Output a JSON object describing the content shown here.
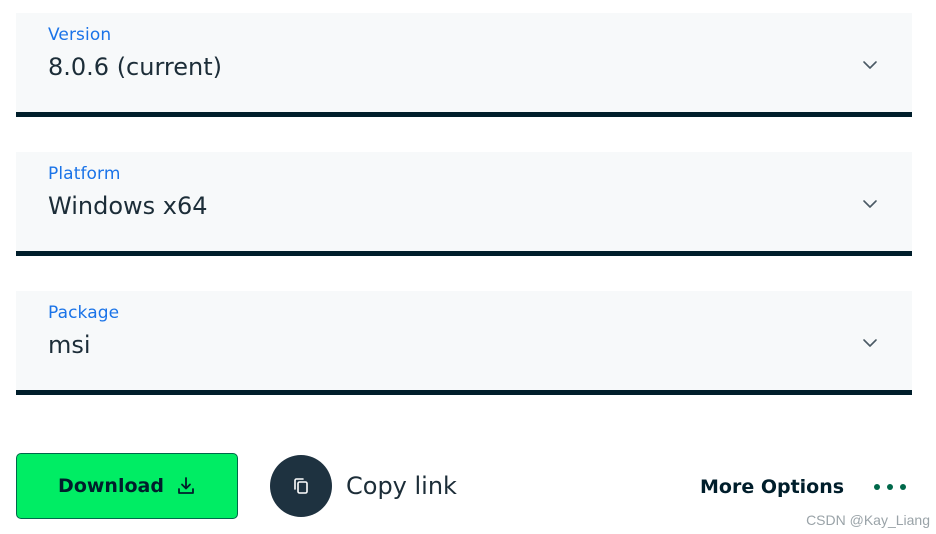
{
  "selects": {
    "version": {
      "label": "Version",
      "value": "8.0.6 (current)"
    },
    "platform": {
      "label": "Platform",
      "value": "Windows x64"
    },
    "package": {
      "label": "Package",
      "value": "msi"
    }
  },
  "actions": {
    "download_label": "Download",
    "copy_link_label": "Copy link",
    "more_options_label": "More Options"
  },
  "icons": {
    "chevron": "chevron-down-icon",
    "download": "download-icon",
    "copy": "copy-icon",
    "more": "more-horizontal-icon"
  },
  "watermark": "CSDN @Kay_Liang",
  "colors": {
    "label_blue": "#1a73e8",
    "button_green": "#00ed64",
    "dark_navy": "#001e2b",
    "field_bg": "#f7f9fa",
    "dots_green": "#00684a"
  }
}
